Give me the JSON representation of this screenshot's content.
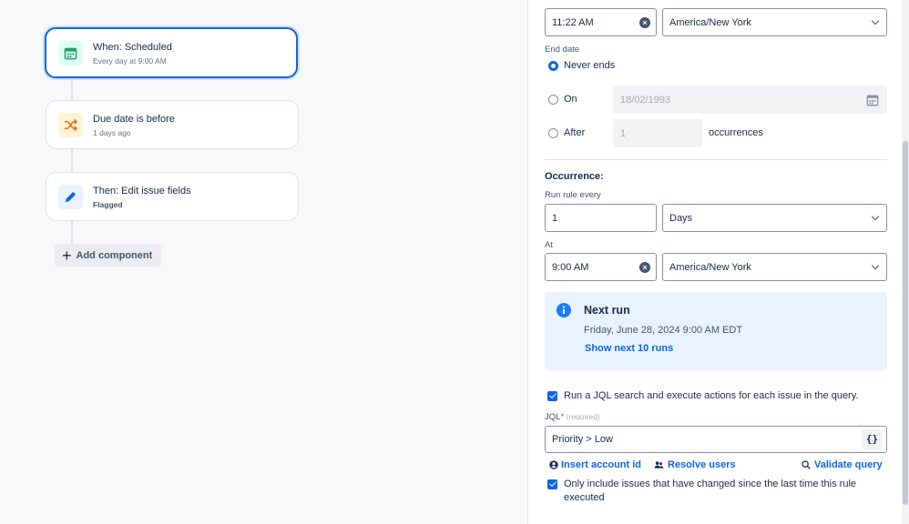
{
  "flow": {
    "trigger": {
      "title": "When: Scheduled",
      "subtitle": "Every day at 9:00 AM",
      "icon": "calendar-icon",
      "color": "#22a06b"
    },
    "condition": {
      "title": "Due date is before",
      "subtitle": "1 days ago",
      "icon": "shuffle-icon",
      "color": "#e56910"
    },
    "action": {
      "title": "Then: Edit issue fields",
      "subtitle": "Flagged",
      "icon": "pencil-icon",
      "color": "#0c66e4"
    },
    "add_component_label": "Add component"
  },
  "schedule": {
    "start_time": "11:22 AM",
    "start_timezone": "America/New York",
    "end_date_label": "End date",
    "never_ends_label": "Never ends",
    "on_label": "On",
    "on_date_placeholder": "18/02/1993",
    "after_label": "After",
    "after_count_placeholder": "1",
    "occurrences_label": "occurrences"
  },
  "occurrence": {
    "heading": "Occurrence:",
    "run_rule_every_label": "Run rule every",
    "interval_value": "1",
    "interval_unit": "Days",
    "at_label": "At",
    "at_time": "9:00 AM",
    "at_timezone": "America/New York"
  },
  "next_run": {
    "title": "Next run",
    "datetime": "Friday, June 28, 2024 9:00 AM EDT",
    "show_next_link": "Show next 10 runs"
  },
  "jql": {
    "run_search_label": "Run a JQL search and execute actions for each issue in the query.",
    "label": "JQL",
    "required_marker": "*",
    "required_hint": "(required)",
    "value": "Priority > Low",
    "braces_button": "{}",
    "insert_account_id": "Insert account id",
    "resolve_users": "Resolve users",
    "validate_query": "Validate query",
    "only_changed_label": "Only include issues that have changed since the last time this rule executed"
  }
}
